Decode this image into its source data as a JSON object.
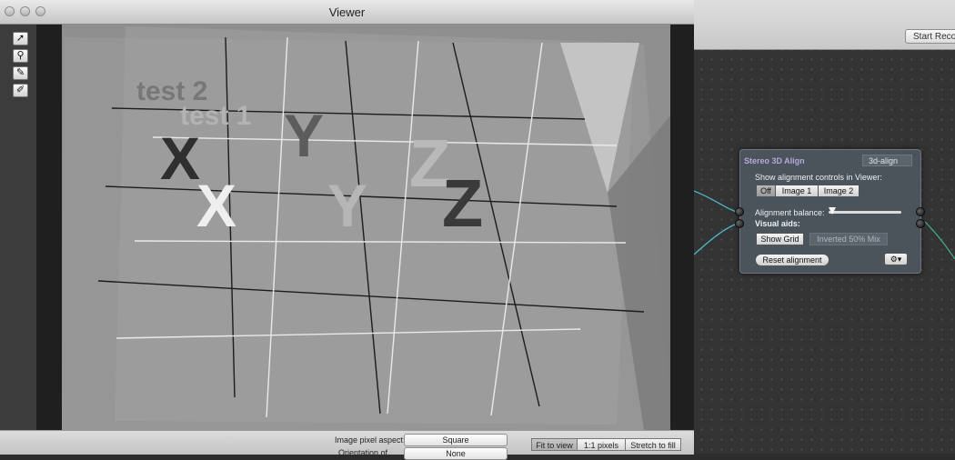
{
  "viewer": {
    "title": "Viewer",
    "tools": [
      {
        "name": "pointer",
        "glyph": "➚"
      },
      {
        "name": "pin",
        "glyph": "⚲"
      },
      {
        "name": "eyedropper",
        "glyph": "✎"
      },
      {
        "name": "eyedropper-plus",
        "glyph": "✐"
      }
    ],
    "image_texts": [
      "test 2",
      "test 1",
      "X",
      "X",
      "Y",
      "Y",
      "Z",
      "Z"
    ],
    "image_pixel_aspect_label": "Image pixel aspect:",
    "image_pixel_aspect_value": "Square",
    "second_label": "Orientation of",
    "second_value": "None",
    "zoom_options": [
      "Fit to view",
      "1:1 pixels",
      "Stretch to fill"
    ],
    "zoom_selected": "Fit to view"
  },
  "editor": {
    "start_record_label": "Start Reco"
  },
  "node": {
    "title": "Stereo 3D Align",
    "name": "3d-align",
    "show_controls_label": "Show alignment controls in Viewer:",
    "view_buttons": [
      "Off",
      "Image 1",
      "Image 2"
    ],
    "view_selected": "Off",
    "balance_label": "Alignment balance:",
    "balance_value": 0.05,
    "visual_aids_label": "Visual aids:",
    "show_grid_label": "Show Grid",
    "inverted_mix_label": "Inverted 50% Mix",
    "reset_label": "Reset alignment",
    "gear_label": "⚙▾"
  },
  "colors": {
    "node_title": "#b8a8dc",
    "wire": "#4ec3d8",
    "wire_out": "#3fb392"
  }
}
